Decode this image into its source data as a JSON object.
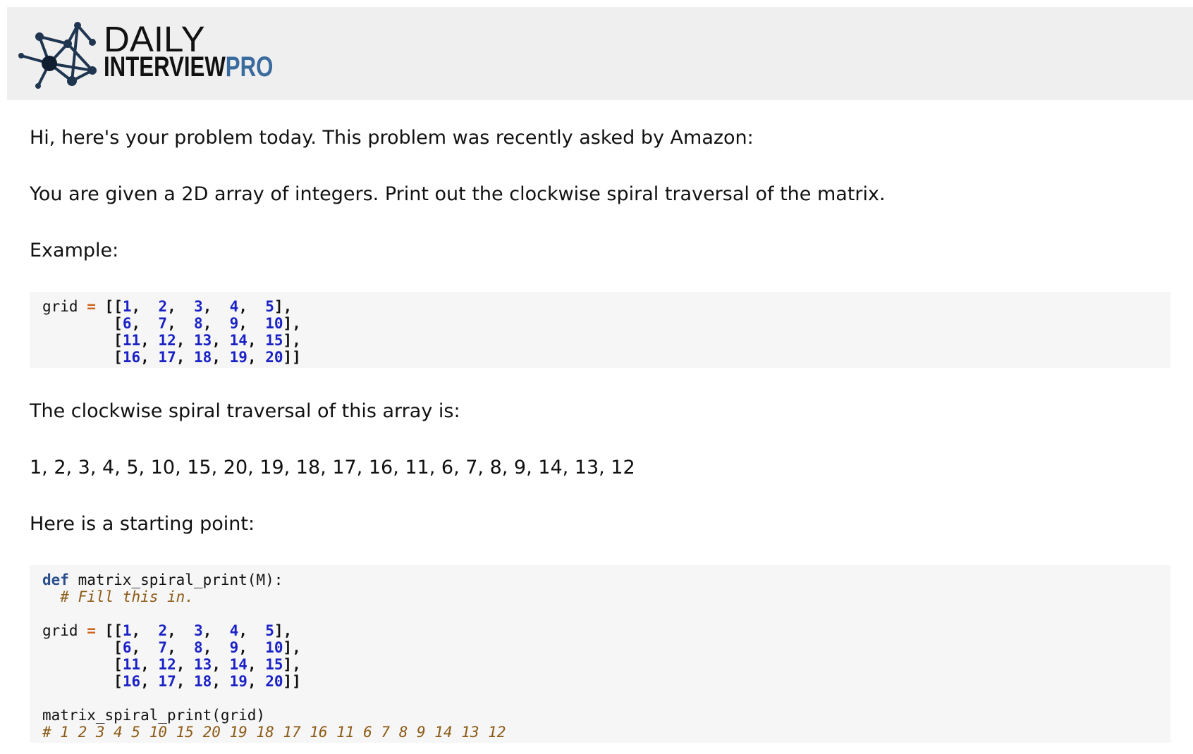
{
  "header": {
    "logo_line1": "DAILY",
    "logo_line2a": "INTERVIEW",
    "logo_line2b": "PRO",
    "brand_color": "#3a6b9f",
    "background": "#efefef"
  },
  "content": {
    "intro": "Hi, here's your problem today. This problem was recently asked by Amazon:",
    "problem": "You are given a 2D array of integers. Print out the clockwise spiral traversal of the matrix.",
    "example_label": "Example:",
    "traversal_label": "The clockwise spiral traversal of this array is:",
    "traversal_result": "1, 2, 3, 4, 5, 10, 15, 20, 19, 18, 17, 16, 11, 6, 7, 8, 9, 14, 13, 12",
    "starting_label": "Here is a starting point:"
  },
  "example_code": {
    "var": "grid",
    "op": "=",
    "rows": [
      [
        "1",
        "2",
        "3",
        "4",
        "5"
      ],
      [
        "6",
        "7",
        "8",
        "9",
        "10"
      ],
      [
        "11",
        "12",
        "13",
        "14",
        "15"
      ],
      [
        "16",
        "17",
        "18",
        "19",
        "20"
      ]
    ]
  },
  "starter_code": {
    "keyword": "def",
    "signature": "matrix_spiral_print(M):",
    "fill_comment": "# Fill this in.",
    "call": "matrix_spiral_print(grid)",
    "output_comment": "# 1 2 3 4 5 10 15 20 19 18 17 16 11 6 7 8 9 14 13 12"
  },
  "code_colors": {
    "number": "#1a22c6",
    "operator": "#d0641f",
    "keyword": "#2a4f8c",
    "comment": "#8c5a16"
  }
}
